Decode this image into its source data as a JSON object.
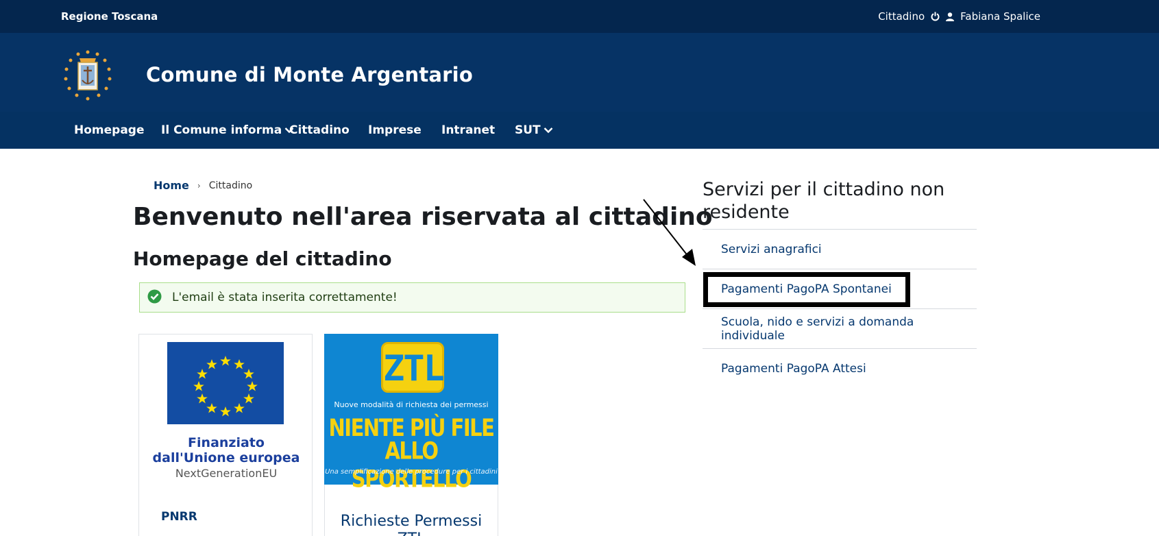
{
  "topbar": {
    "region": "Regione Toscana",
    "role": "Cittadino",
    "user_name": "Fabiana Spalice",
    "icons": [
      "power-icon",
      "user-icon"
    ]
  },
  "header": {
    "site_title": "Comune di Monte Argentario",
    "logo": "comune-crest-logo"
  },
  "nav": {
    "items": [
      {
        "label": "Homepage",
        "has_dropdown": false
      },
      {
        "label": "Il Comune informa",
        "has_dropdown": true
      },
      {
        "label": "Cittadino",
        "has_dropdown": false
      },
      {
        "label": "Imprese",
        "has_dropdown": false
      },
      {
        "label": "Intranet",
        "has_dropdown": false
      },
      {
        "label": "SUT",
        "has_dropdown": true
      }
    ]
  },
  "breadcrumb": {
    "home": "Home",
    "separator": "›",
    "current": "Cittadino"
  },
  "main": {
    "page_title": "Benvenuto nell'area riservata al cittadino",
    "section_title": "Homepage del cittadino",
    "alert": {
      "message": "L'email è stata inserita correttamente!",
      "type": "success"
    },
    "cards": [
      {
        "image_text": [
          "Finanziato",
          "dall'Unione europea",
          "NextGenerationEU"
        ],
        "title": "PNRR"
      },
      {
        "image_text": {
          "badge": "ZTL",
          "subtitle": "Nuove modalità di richiesta dei permessi",
          "line1": "NIENTE PIÙ FILE",
          "line2": "ALLO SPORTELLO",
          "tagline": "Una semplificazione delle procedure per i cittadini"
        },
        "title": "Richieste Permessi ZTL"
      }
    ]
  },
  "sidebar": {
    "title": "Servizi per il cittadino non residente",
    "items": [
      {
        "label": "Servizi anagrafici"
      },
      {
        "label": "Pagamenti PagoPA Spontanei"
      },
      {
        "label": "Scuola, nido e servizi a domanda individuale"
      },
      {
        "label": "Pagamenti PagoPA Attesi"
      }
    ]
  },
  "colors": {
    "topbar": "#04264e",
    "header": "#063365",
    "link": "#06386f",
    "alert_border": "#a9de8a"
  }
}
